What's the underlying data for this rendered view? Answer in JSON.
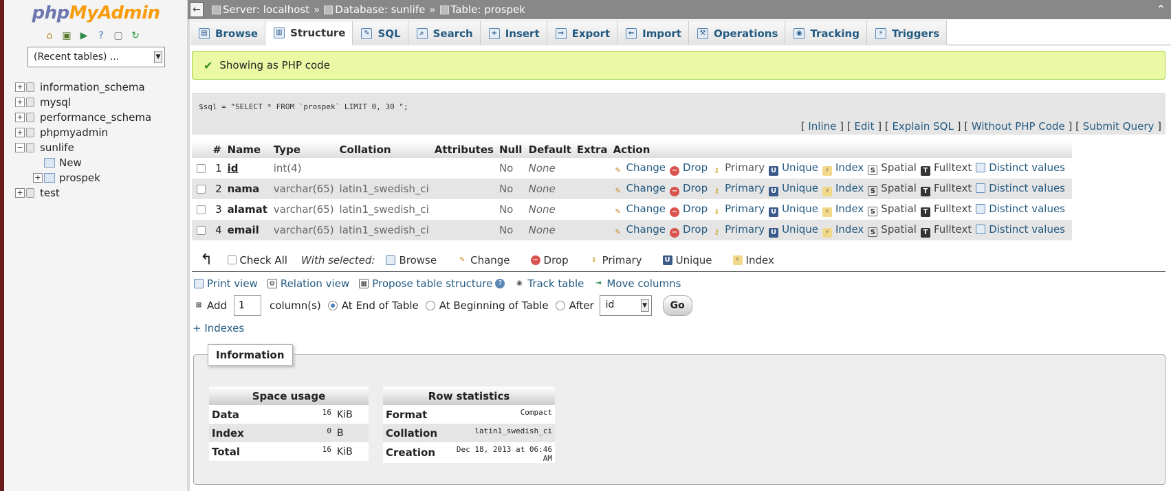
{
  "logo": {
    "php": "php",
    "my": "MyAdmin"
  },
  "nav": {
    "recent_tables": "(Recent tables) ...",
    "databases": [
      "information_schema",
      "mysql",
      "performance_schema",
      "phpmyadmin",
      "sunlife",
      "test"
    ],
    "sunlife_children": [
      "New",
      "prospek"
    ]
  },
  "breadcrumb": {
    "server": "Server: localhost",
    "sep": "»",
    "database": "Database: sunlife",
    "table": "Table: prospek"
  },
  "tabs": [
    "Browse",
    "Structure",
    "SQL",
    "Search",
    "Insert",
    "Export",
    "Import",
    "Operations",
    "Tracking",
    "Triggers"
  ],
  "message": "Showing as PHP code",
  "sql": {
    "code": "$sql = \"SELECT * FROM `prospek` LIMIT 0, 30 \";",
    "links": [
      "Inline",
      "Edit",
      "Explain SQL",
      "Without PHP Code",
      "Submit Query"
    ]
  },
  "structure": {
    "headers": [
      "#",
      "Name",
      "Type",
      "Collation",
      "Attributes",
      "Null",
      "Default",
      "Extra",
      "Action"
    ],
    "rows": [
      {
        "num": "1",
        "name": "id",
        "type": "int(4)",
        "collation": "",
        "attributes": "",
        "null": "No",
        "default": "None",
        "extra": ""
      },
      {
        "num": "2",
        "name": "nama",
        "type": "varchar(65)",
        "collation": "latin1_swedish_ci",
        "attributes": "",
        "null": "No",
        "default": "None",
        "extra": ""
      },
      {
        "num": "3",
        "name": "alamat",
        "type": "varchar(65)",
        "collation": "latin1_swedish_ci",
        "attributes": "",
        "null": "No",
        "default": "None",
        "extra": ""
      },
      {
        "num": "4",
        "name": "email",
        "type": "varchar(65)",
        "collation": "latin1_swedish_ci",
        "attributes": "",
        "null": "No",
        "default": "None",
        "extra": ""
      }
    ],
    "actions": [
      "Change",
      "Drop",
      "Primary",
      "Unique",
      "Index",
      "Spatial",
      "Fulltext",
      "Distinct values"
    ]
  },
  "with_selected": {
    "check_all": "Check All",
    "label": "With selected:",
    "items": [
      "Browse",
      "Change",
      "Drop",
      "Primary",
      "Unique",
      "Index"
    ]
  },
  "tools": {
    "print_view": "Print view",
    "relation_view": "Relation view",
    "propose": "Propose table structure",
    "track_table": "Track table",
    "move_columns": "Move columns"
  },
  "add_column": {
    "add": "Add",
    "count": "1",
    "columns": "column(s)",
    "at_end": "At End of Table",
    "at_beginning": "At Beginning of Table",
    "after": "After",
    "after_field": "id",
    "go": "Go"
  },
  "indexes_link": "+ Indexes",
  "information": {
    "legend": "Information",
    "space_usage": {
      "title": "Space usage",
      "rows": [
        {
          "label": "Data",
          "value": "16",
          "unit": "KiB"
        },
        {
          "label": "Index",
          "value": "0",
          "unit": "B"
        },
        {
          "label": "Total",
          "value": "16",
          "unit": "KiB"
        }
      ]
    },
    "row_statistics": {
      "title": "Row statistics",
      "rows": [
        {
          "label": "Format",
          "value": "Compact"
        },
        {
          "label": "Collation",
          "value": "latin1_swedish_ci"
        },
        {
          "label": "Creation",
          "value": "Dec 18, 2013 at 06:46 AM"
        }
      ]
    }
  }
}
